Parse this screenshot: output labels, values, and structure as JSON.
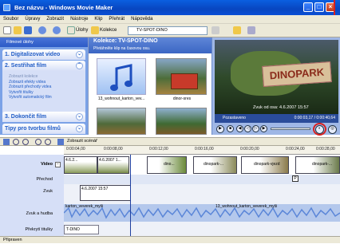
{
  "window": {
    "title": "Bez názvu - Windows Movie Maker"
  },
  "menu": [
    "Soubor",
    "Úpravy",
    "Zobrazit",
    "Nástroje",
    "Klip",
    "Přehrát",
    "Nápověda"
  ],
  "toolbar": {
    "tasks_label": "Úlohy",
    "collections_label": "Kolekce",
    "collection_select": "TV-SPOT-DINO"
  },
  "tasks": {
    "header": "Filmové úlohy",
    "sections": [
      {
        "number": "1.",
        "title": "Digitalizovat video"
      },
      {
        "number": "2.",
        "title": "Sestřihat film"
      },
      {
        "number": "3.",
        "title": "Dokončit film"
      },
      {
        "title": "Tipy pro tvorbu filmů"
      }
    ],
    "edit_links": [
      "Zobrazit kolekce",
      "Zobrazit efekty videa",
      "Zobrazit přechody videa",
      "Vytvořit titulky",
      "Vytvořit automatický film"
    ]
  },
  "collection": {
    "title": "Kolekce: TV-SPOT-DINO",
    "subtitle": "Přetáhněte klip na časovou osu.",
    "items": [
      {
        "caption": "13_wohnout_karton_vev..."
      },
      {
        "caption": "dinor-sres"
      },
      {
        "caption": ""
      },
      {
        "caption": ""
      }
    ]
  },
  "player": {
    "status": "Pozastaveno",
    "time": "0:00:03,17 / 0:00:40,64",
    "overlay_date": "Zvuk od osa: 4.6.2007 15:57",
    "logo_text": "DINOPARK"
  },
  "timeline": {
    "show_storyboard": "Zobrazit scénář",
    "ticks": [
      "0:00:04,00",
      "0:00:08,00",
      "0:00:12,00",
      "0:00:16,00",
      "0:00:20,00",
      "0:00:24,00",
      "0:00:28,00"
    ],
    "tracks": {
      "video": "Video",
      "transition": "Přechod",
      "audio": "Zvuk",
      "audio_music": "Zvuk a hudba",
      "title_overlay": "Překrytí titulky"
    },
    "clips": {
      "video": [
        "4.6.2...",
        "4.6.2007 1...",
        "dino...",
        "dinopark-...",
        "dinopark-vjezd",
        "dinopark-..."
      ],
      "audio": "4.6.2007 15:57",
      "music": [
        "karton_veverek_myši",
        "13_wohnout_karton_veverek_myši"
      ],
      "title": "T-DINO",
      "transition_marker": "P"
    }
  },
  "status": {
    "text": "Připraven"
  }
}
